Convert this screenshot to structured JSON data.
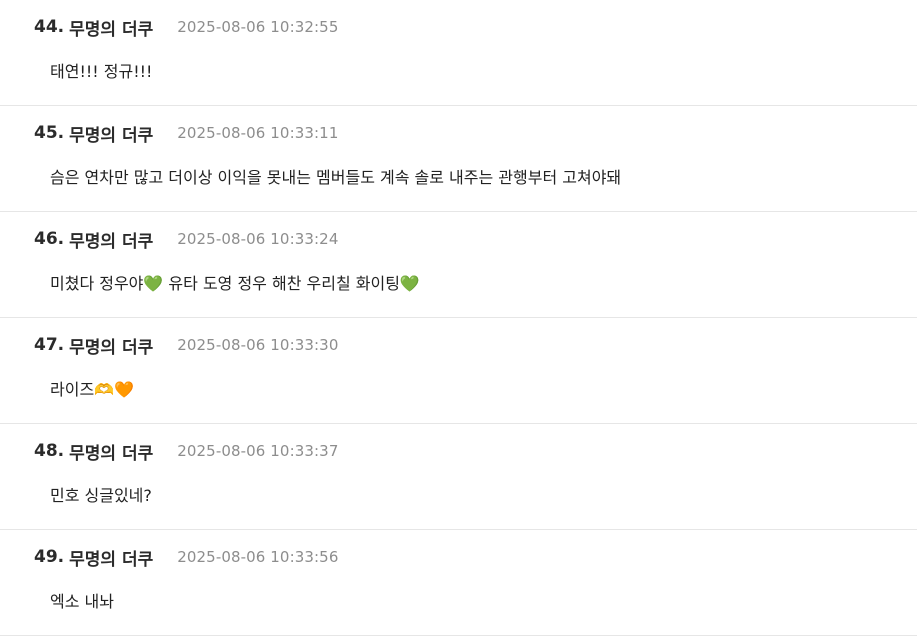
{
  "comments": [
    {
      "number": "44.",
      "author": "무명의 더쿠",
      "time": "2025-08-06 10:32:55",
      "text": "태연!!! 정규!!!"
    },
    {
      "number": "45.",
      "author": "무명의 더쿠",
      "time": "2025-08-06 10:33:11",
      "text": "슴은 연차만 많고 더이상 이익을 못내는 멤버들도 계속 솔로 내주는 관행부터 고쳐야돼"
    },
    {
      "number": "46.",
      "author": "무명의 더쿠",
      "time": "2025-08-06 10:33:24",
      "text": "미쳤다 정우야💚 유타 도영 정우 해찬 우리칠 화이팅💚"
    },
    {
      "number": "47.",
      "author": "무명의 더쿠",
      "time": "2025-08-06 10:33:30",
      "text": "라이즈🫶🧡"
    },
    {
      "number": "48.",
      "author": "무명의 더쿠",
      "time": "2025-08-06 10:33:37",
      "text": "민호 싱글있네?"
    },
    {
      "number": "49.",
      "author": "무명의 더쿠",
      "time": "2025-08-06 10:33:56",
      "text": "엑소 내놔"
    }
  ]
}
